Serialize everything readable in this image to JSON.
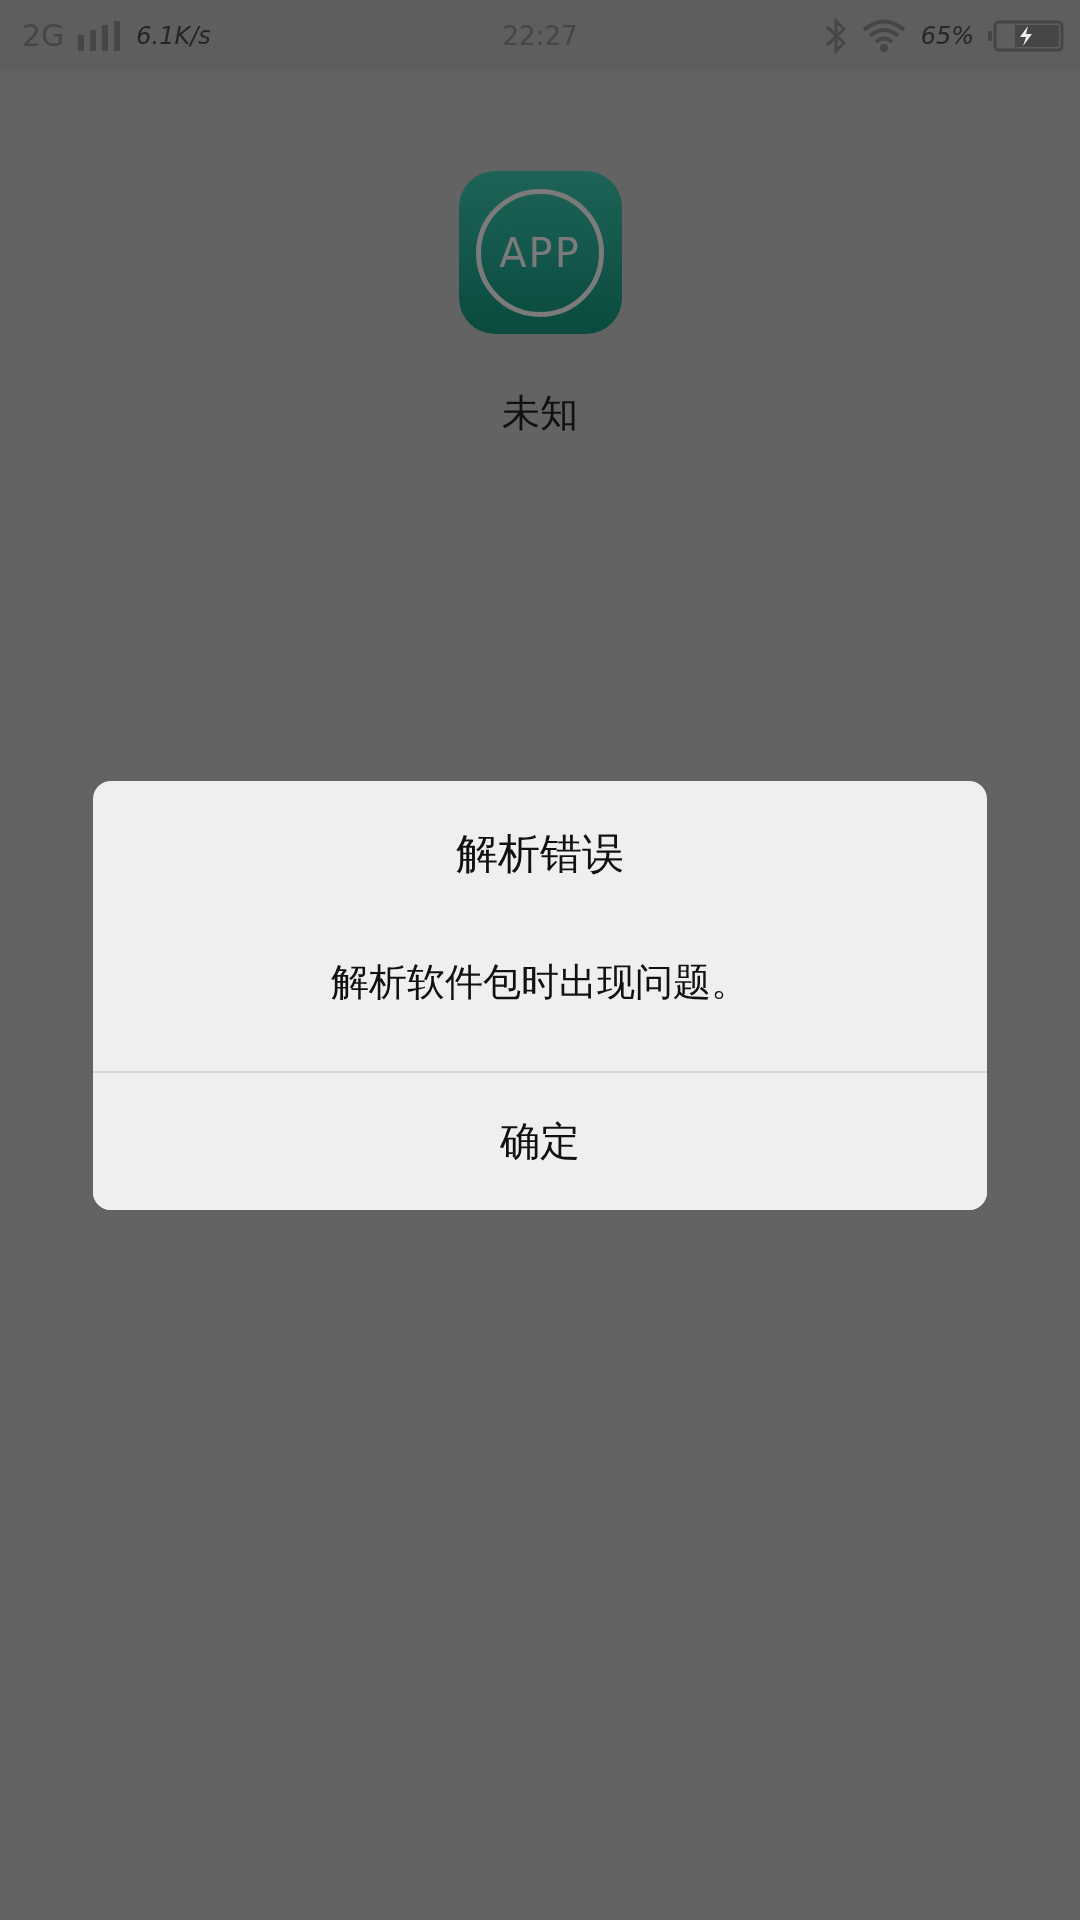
{
  "status_bar": {
    "network": "2G",
    "speed": "6.1K/s",
    "time": "22:27",
    "battery": "65%"
  },
  "app": {
    "icon_text": "APP",
    "name": "未知"
  },
  "dialog": {
    "title": "解析错误",
    "message": "解析软件包时出现问题。",
    "buttons": [
      "确定"
    ]
  }
}
